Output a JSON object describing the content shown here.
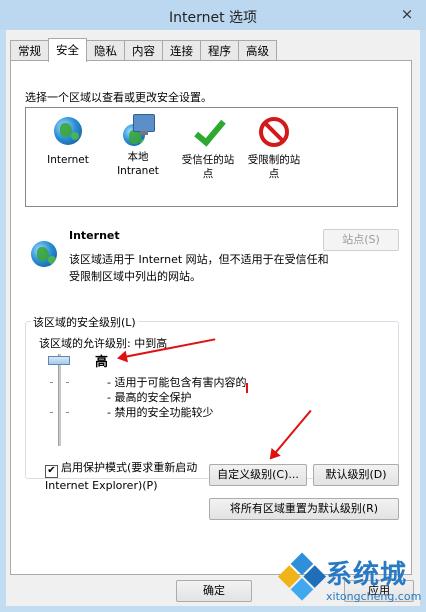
{
  "window": {
    "title": "Internet 选项",
    "close_icon": "×"
  },
  "tabs": [
    "常规",
    "安全",
    "隐私",
    "内容",
    "连接",
    "程序",
    "高级"
  ],
  "active_tab": "安全",
  "security": {
    "instruction": "选择一个区域以查看或更改安全设置。",
    "zones": [
      {
        "label": "Internet",
        "icon": "globe-icon"
      },
      {
        "label": "本地\nIntranet",
        "icon": "intranet-icon"
      },
      {
        "label": "受信任的站\n点",
        "icon": "check-icon"
      },
      {
        "label": "受限制的站\n点",
        "icon": "restricted-icon"
      }
    ],
    "selected_zone": {
      "name": "Internet",
      "description": "该区域适用于 Internet 网站，但不适用于在受信任和受限制区域中列出的网站。"
    },
    "sites_button": "站点(S)",
    "group_label": "该区域的安全级别(L)",
    "allowed_level": "该区域的允许级别: 中到高",
    "level_name": "高",
    "level_details": [
      "- 适用于可能包含有害内容的",
      "- 最高的安全保护",
      "- 禁用的安全功能较少"
    ],
    "slider_level": 0.0,
    "protected_mode": {
      "checked": true,
      "label": "启用保护模式(要求重新启动 Internet Explorer)(P)"
    },
    "custom_level_button": "自定义级别(C)...",
    "default_level_button": "默认级别(D)",
    "reset_all_button": "将所有区域重置为默认级别(R)"
  },
  "footer": {
    "ok_button": "确定",
    "apply_button": "应用"
  },
  "watermark": {
    "brand": "系统城",
    "url": "xitongcheng.com"
  },
  "colors": {
    "accent": "#2979c4",
    "annotation_red": "#e01010",
    "frame": "#c2dcf2"
  }
}
